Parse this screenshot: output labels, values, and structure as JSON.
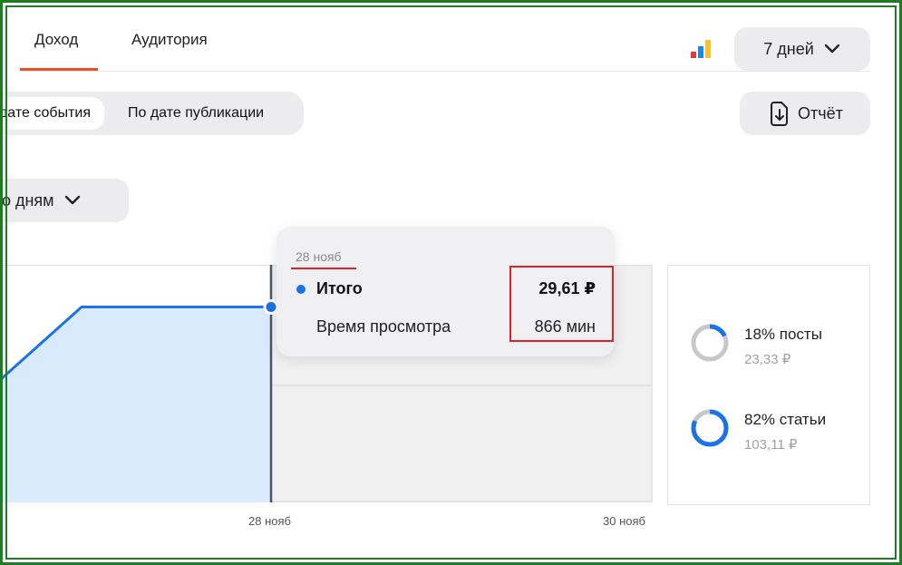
{
  "tabs": [
    {
      "label": "Доход",
      "active": true
    },
    {
      "label": "Аудитория",
      "active": false
    }
  ],
  "header": {
    "chart_icon": "bar-chart-icon",
    "period_label": "7 дней"
  },
  "filter": {
    "segments": [
      {
        "label": "По дате события",
        "active": true
      },
      {
        "label": "По дате публикации",
        "active": false
      }
    ],
    "report_label": "Отчёт",
    "grouping_label": "По дням"
  },
  "tooltip": {
    "date": "28 нояб",
    "rows": [
      {
        "label": "Итого",
        "value": "29,61 ₽"
      },
      {
        "label": "Время просмотра",
        "value": "866 мин"
      }
    ]
  },
  "breakdown": [
    {
      "label": "18% посты",
      "value": "23,33 ₽",
      "percent": 18
    },
    {
      "label": "82% статьи",
      "value": "103,11 ₽",
      "percent": 82
    }
  ],
  "colors": {
    "accent_tab": "#e2522b",
    "series": "#1a73e8",
    "series_fill": "#d9eafc",
    "highlight": "#d8252a",
    "frame": "#1e7d22"
  },
  "chart_data": {
    "type": "area",
    "x_tick_labels": [
      "28 нояб",
      "30 нояб"
    ],
    "series": [
      {
        "name": "Итого",
        "values": [
          27.5,
          29.61,
          29.61,
          29.61
        ]
      }
    ],
    "highlighted_point": {
      "x": "28 нояб",
      "value": 29.61
    },
    "grid": true
  }
}
